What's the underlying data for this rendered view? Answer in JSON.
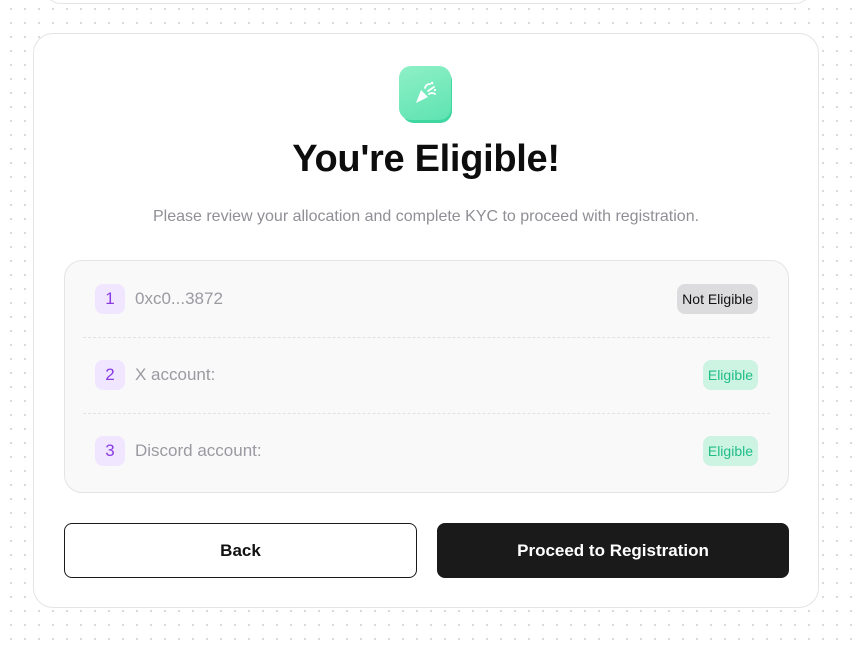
{
  "header": {
    "icon": "party-popper-icon",
    "title": "You're Eligible!",
    "subtitle": "Please review your allocation and complete KYC to proceed with registration."
  },
  "eligibility_list": [
    {
      "number": "1",
      "label": "0xc0...3872",
      "status": "Not Eligible"
    },
    {
      "number": "2",
      "label": "X account:",
      "status": "Eligible"
    },
    {
      "number": "3",
      "label": "Discord account:",
      "status": "Eligible"
    }
  ],
  "actions": {
    "back_label": "Back",
    "proceed_label": "Proceed to Registration"
  },
  "colors": {
    "accent_green": "#5fe3b2",
    "eligible_text": "#1fbe85",
    "eligible_bg": "#cdf3e3",
    "not_eligible_bg": "#dcdcdf",
    "number_text": "#8a3ae0",
    "number_bg": "#f0e6ff",
    "primary_button": "#1a1a1a"
  }
}
